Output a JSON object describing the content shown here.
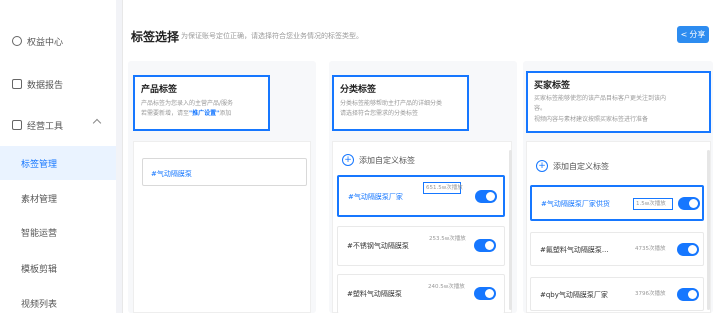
{
  "sidebar": {
    "items": [
      {
        "label": "权益中心",
        "icon": "shield-icon"
      },
      {
        "label": "数据报告",
        "icon": "chart-icon"
      },
      {
        "label": "经营工具",
        "icon": "toolbox-icon"
      },
      {
        "label": "标签管理",
        "active": true
      },
      {
        "label": "素材管理"
      },
      {
        "label": "智能运营"
      },
      {
        "label": "模板剪辑"
      },
      {
        "label": "视频列表"
      }
    ]
  },
  "header": {
    "title": "标签选择",
    "hint": "为保证账号定位正确，请选择符合您业务情况的标签类型。",
    "share_label": "分享",
    "share_icon": "share-icon"
  },
  "columns": {
    "product": {
      "title": "产品标签",
      "desc_line1": "产品标签为您录入的主营产品/服务",
      "desc_line2_a": "若需要新增，请至",
      "desc_line2_hl": "\"推广设置\"",
      "desc_line2_b": "添加",
      "tags": [
        "#气动隔膜泵"
      ]
    },
    "category": {
      "title": "分类标签",
      "desc_line1": "分类标签能够帮助主打产品的详细分类",
      "desc_line2": "请选择符合您需求的分类标签",
      "add_label": "添加自定义标签",
      "tags": [
        {
          "name": "#气动隔膜泵厂家",
          "count": "651.5w次播放",
          "selected": true
        },
        {
          "name": "#不锈钢气动隔膜泵",
          "count": "253.5w次播放",
          "selected": false
        },
        {
          "name": "#塑料气动隔膜泵",
          "count": "240.5w次播放",
          "selected": false
        }
      ]
    },
    "buyer": {
      "title": "买家标签",
      "desc_line1": "买家标签能够使您的该产品目标客户更关注到该内",
      "desc_line2": "容。",
      "desc_line3": "视频内容与素材建议按照买家标签进行准备",
      "add_label": "添加自定义标签",
      "tags": [
        {
          "name": "#气动隔膜泵厂家供货",
          "count": "1.5w次播放",
          "selected": true
        },
        {
          "name": "#氟塑料气动隔膜泵...",
          "count": "4735次播放",
          "selected": false
        },
        {
          "name": "#qby气动隔膜泵厂家",
          "count": "3796次播放",
          "selected": false
        }
      ]
    }
  },
  "colors": {
    "accent": "#1677ff",
    "share_bg": "#2d8cf0"
  }
}
